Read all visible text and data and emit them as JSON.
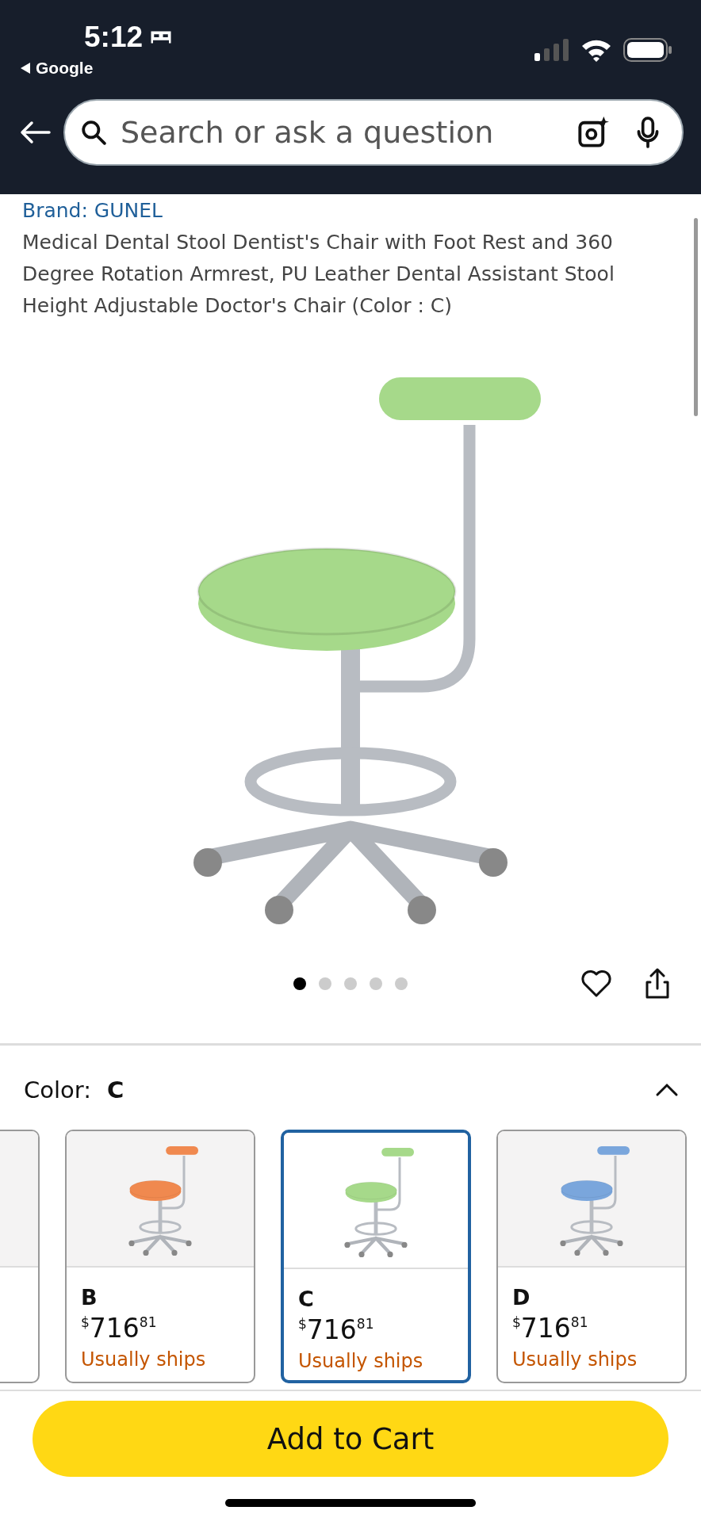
{
  "status_bar": {
    "time": "5:12",
    "back_app": "Google"
  },
  "search": {
    "placeholder": "Search or ask a question"
  },
  "product": {
    "brand": "Brand: GUNEL",
    "title": "Medical Dental Stool Dentist's Chair with Foot Rest and 360 Degree Rotation Armrest, PU Leather Dental Assistant Stool Height Adjustable Doctor's Chair (Color : C)"
  },
  "carousel_dots": [
    {
      "selected": true
    },
    {
      "selected": false
    },
    {
      "selected": false
    },
    {
      "selected": false
    },
    {
      "selected": false
    }
  ],
  "color_section": {
    "label": "Color:",
    "value": "C",
    "expanded": true
  },
  "swatches": [
    {
      "name": "B",
      "currency": "$",
      "price_whole": "716",
      "price_fraction": "81",
      "shipping": "Usually ships",
      "color": "#f0894f",
      "selected": false
    },
    {
      "name": "C",
      "currency": "$",
      "price_whole": "716",
      "price_fraction": "81",
      "shipping": "Usually ships",
      "color": "#a6d98a",
      "selected": true
    },
    {
      "name": "D",
      "currency": "$",
      "price_whole": "716",
      "price_fraction": "81",
      "shipping": "Usually ships",
      "color": "#7aa6dc",
      "selected": false
    }
  ],
  "cart_button": "Add to Cart"
}
